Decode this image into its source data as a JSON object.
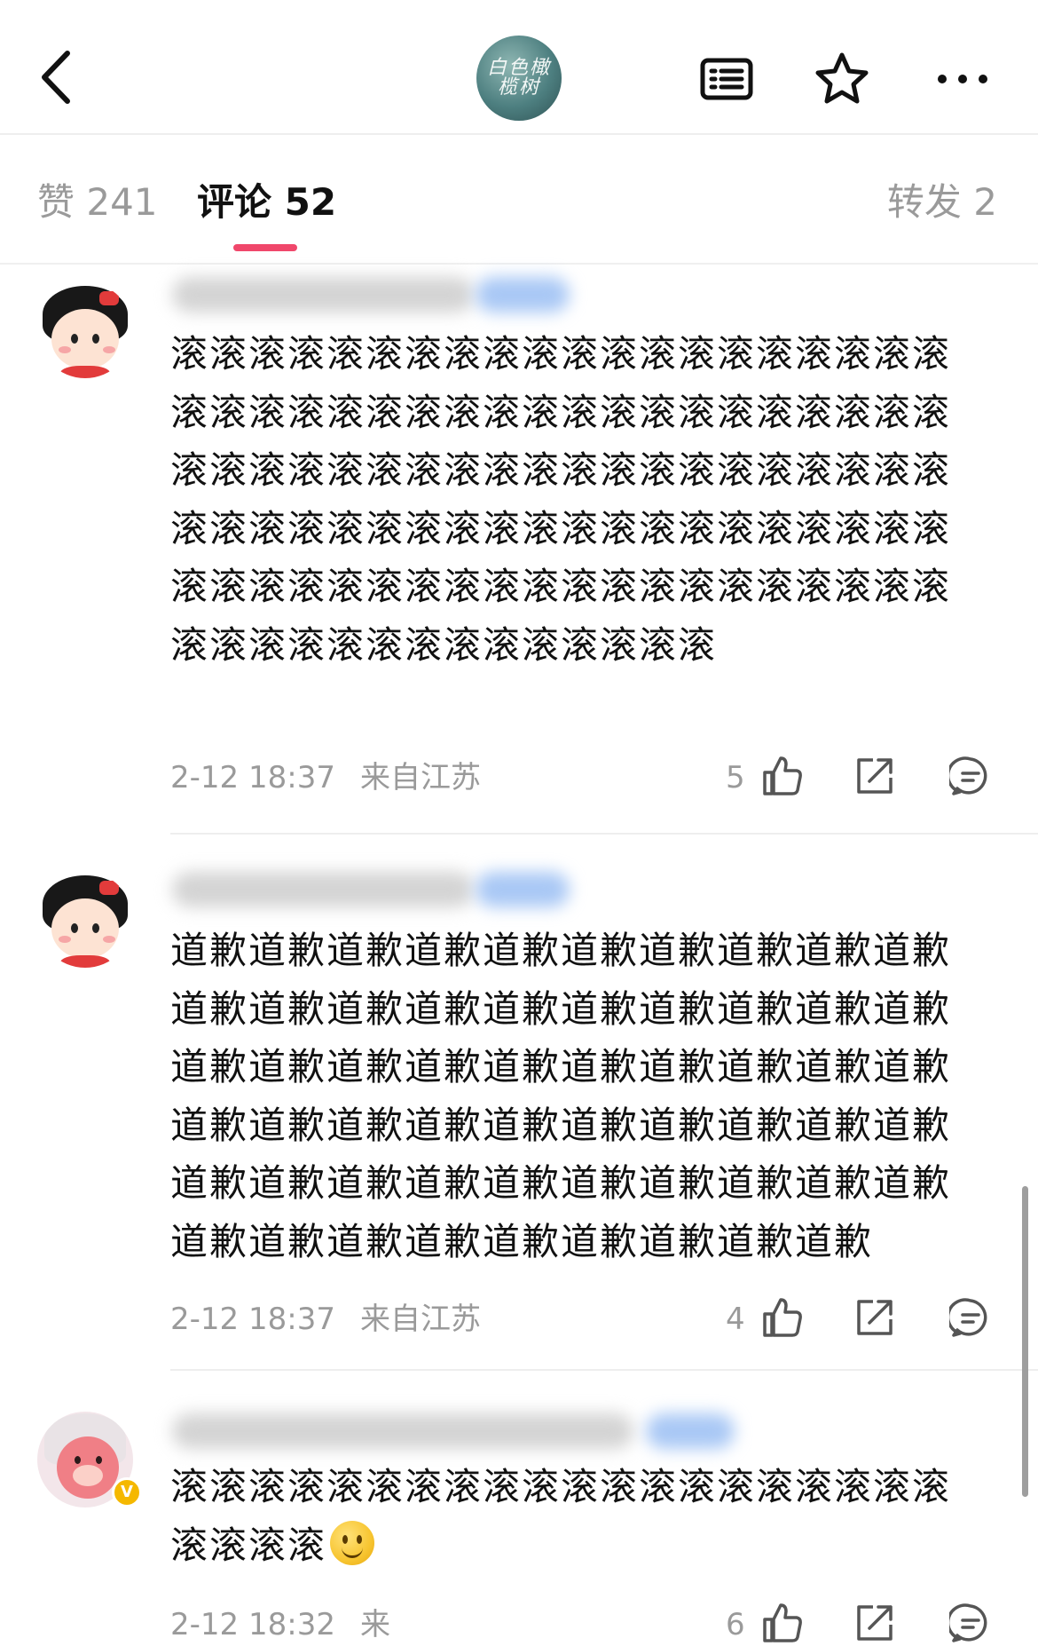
{
  "header": {
    "back_icon": "chevron-left-icon",
    "account_avatar_text": "白色橄榄树",
    "icons": [
      "list-view-icon",
      "star-icon",
      "more-icon"
    ]
  },
  "tabs": [
    {
      "label": "赞 241"
    },
    {
      "label": "评论 52",
      "active": true
    },
    {
      "label": "转发 2"
    }
  ],
  "accent_color": "#f0476b",
  "comments": [
    {
      "text": "滚滚滚滚滚滚滚滚滚滚滚滚滚滚滚滚滚滚滚滚滚滚滚滚滚滚滚滚滚滚滚滚滚滚滚滚滚滚滚滚滚滚滚滚滚滚滚滚滚滚滚滚滚滚滚滚滚滚滚滚滚滚滚滚滚滚滚滚滚滚滚滚滚滚滚滚滚滚滚滚滚滚滚滚滚滚滚滚滚滚滚滚滚滚滚滚滚滚滚滚滚滚滚滚滚滚滚滚滚滚滚滚滚滚",
      "time": "2-12 18:37",
      "location": "来自江苏",
      "likes": "5"
    },
    {
      "text": "道歉道歉道歉道歉道歉道歉道歉道歉道歉道歉道歉道歉道歉道歉道歉道歉道歉道歉道歉道歉道歉道歉道歉道歉道歉道歉道歉道歉道歉道歉道歉道歉道歉道歉道歉道歉道歉道歉道歉道歉道歉道歉道歉道歉道歉道歉道歉道歉道歉道歉道歉道歉道歉道歉道歉道歉道歉道歉道歉",
      "time": "2-12 18:37",
      "location": "来自江苏",
      "likes": "4"
    },
    {
      "text": "滚滚滚滚滚滚滚滚滚滚滚滚滚滚滚滚滚滚滚滚滚滚滚滚",
      "emoji": "smile-emoji",
      "time": "2-12 18:32",
      "location": "来",
      "likes": "6"
    }
  ]
}
